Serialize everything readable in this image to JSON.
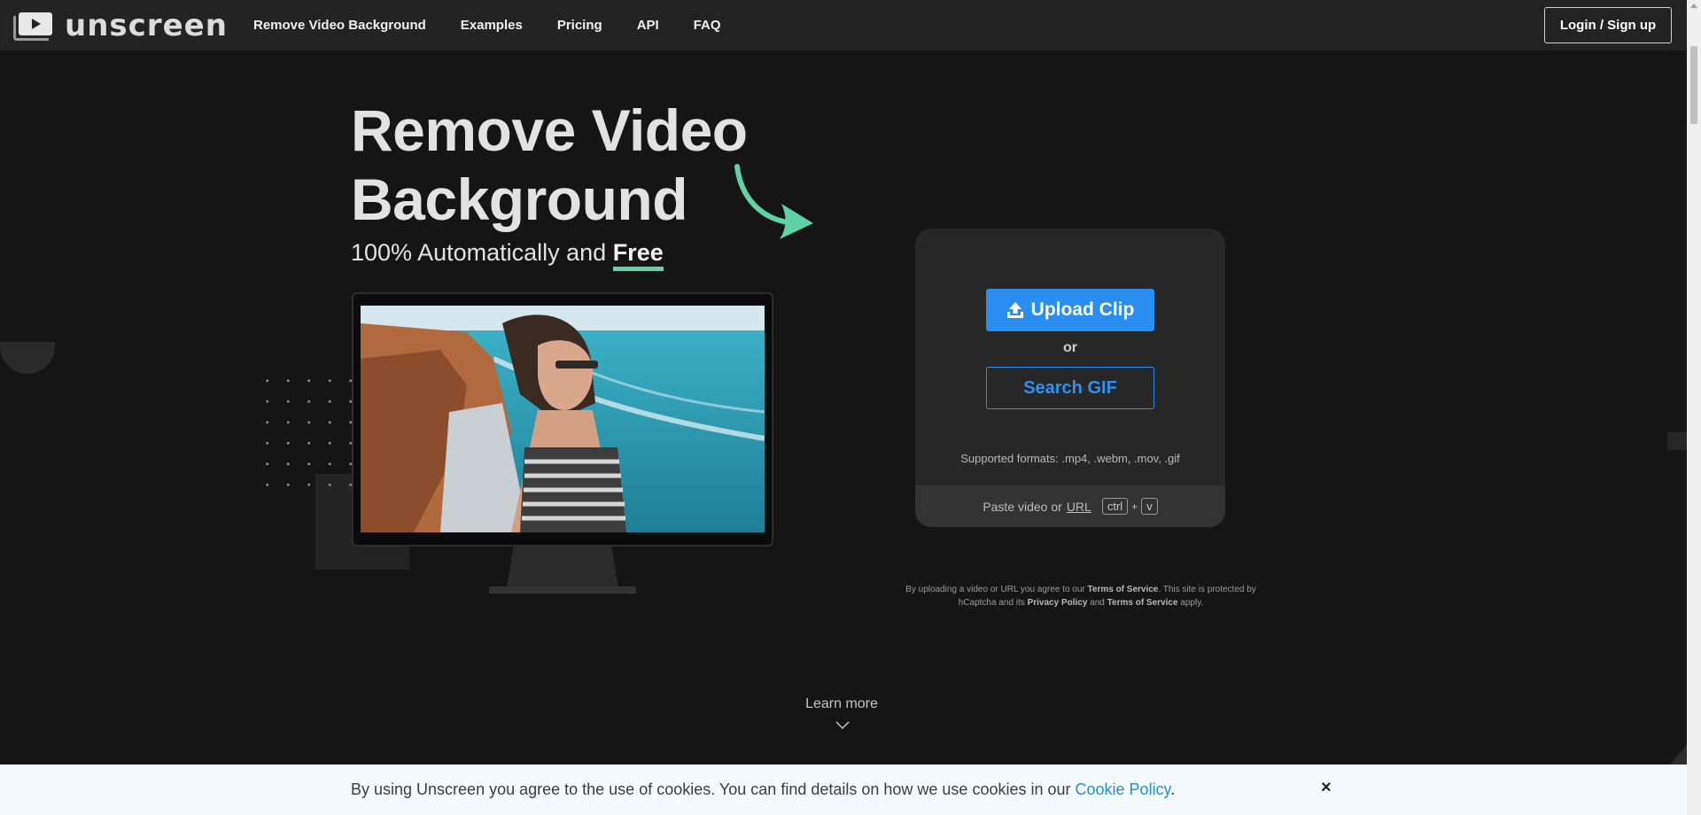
{
  "brand": {
    "name": "unscreen"
  },
  "nav": {
    "links": [
      "Remove Video Background",
      "Examples",
      "Pricing",
      "API",
      "FAQ"
    ],
    "login_label": "Login / Sign up"
  },
  "hero": {
    "title_line1": "Remove Video",
    "title_line2": "Background",
    "subtitle_prefix": "100% Automatically and ",
    "subtitle_free": "Free"
  },
  "upload": {
    "upload_label": "Upload Clip",
    "or_label": "or",
    "search_gif_label": "Search GIF",
    "formats_text": "Supported formats: .mp4, .webm, .mov, .gif",
    "paste_prefix": "Paste video or",
    "paste_url": "URL",
    "key_ctrl": "ctrl",
    "key_plus": "+",
    "key_v": "v"
  },
  "legal": {
    "t1": "By uploading a video or URL you agree to our ",
    "tos1": "Terms of Service",
    "t2": ". This site is protected by hCaptcha and its ",
    "privacy": "Privacy Policy",
    "t3": " and ",
    "tos2": "Terms of Service",
    "t4": " apply."
  },
  "learn_more": {
    "label": "Learn more"
  },
  "cookie": {
    "text": "By using Unscreen you agree to the use of cookies. You can find details on how we use cookies in our ",
    "link": "Cookie Policy",
    "suffix": ".",
    "close": "×"
  },
  "colors": {
    "accent_blue": "#2a8ef0",
    "accent_green": "#5fd3a6",
    "background": "#151515",
    "navbar": "#232323"
  },
  "icons": [
    "upload-icon",
    "curved-arrow-icon",
    "chevron-down-icon",
    "close-icon",
    "play-icon"
  ]
}
